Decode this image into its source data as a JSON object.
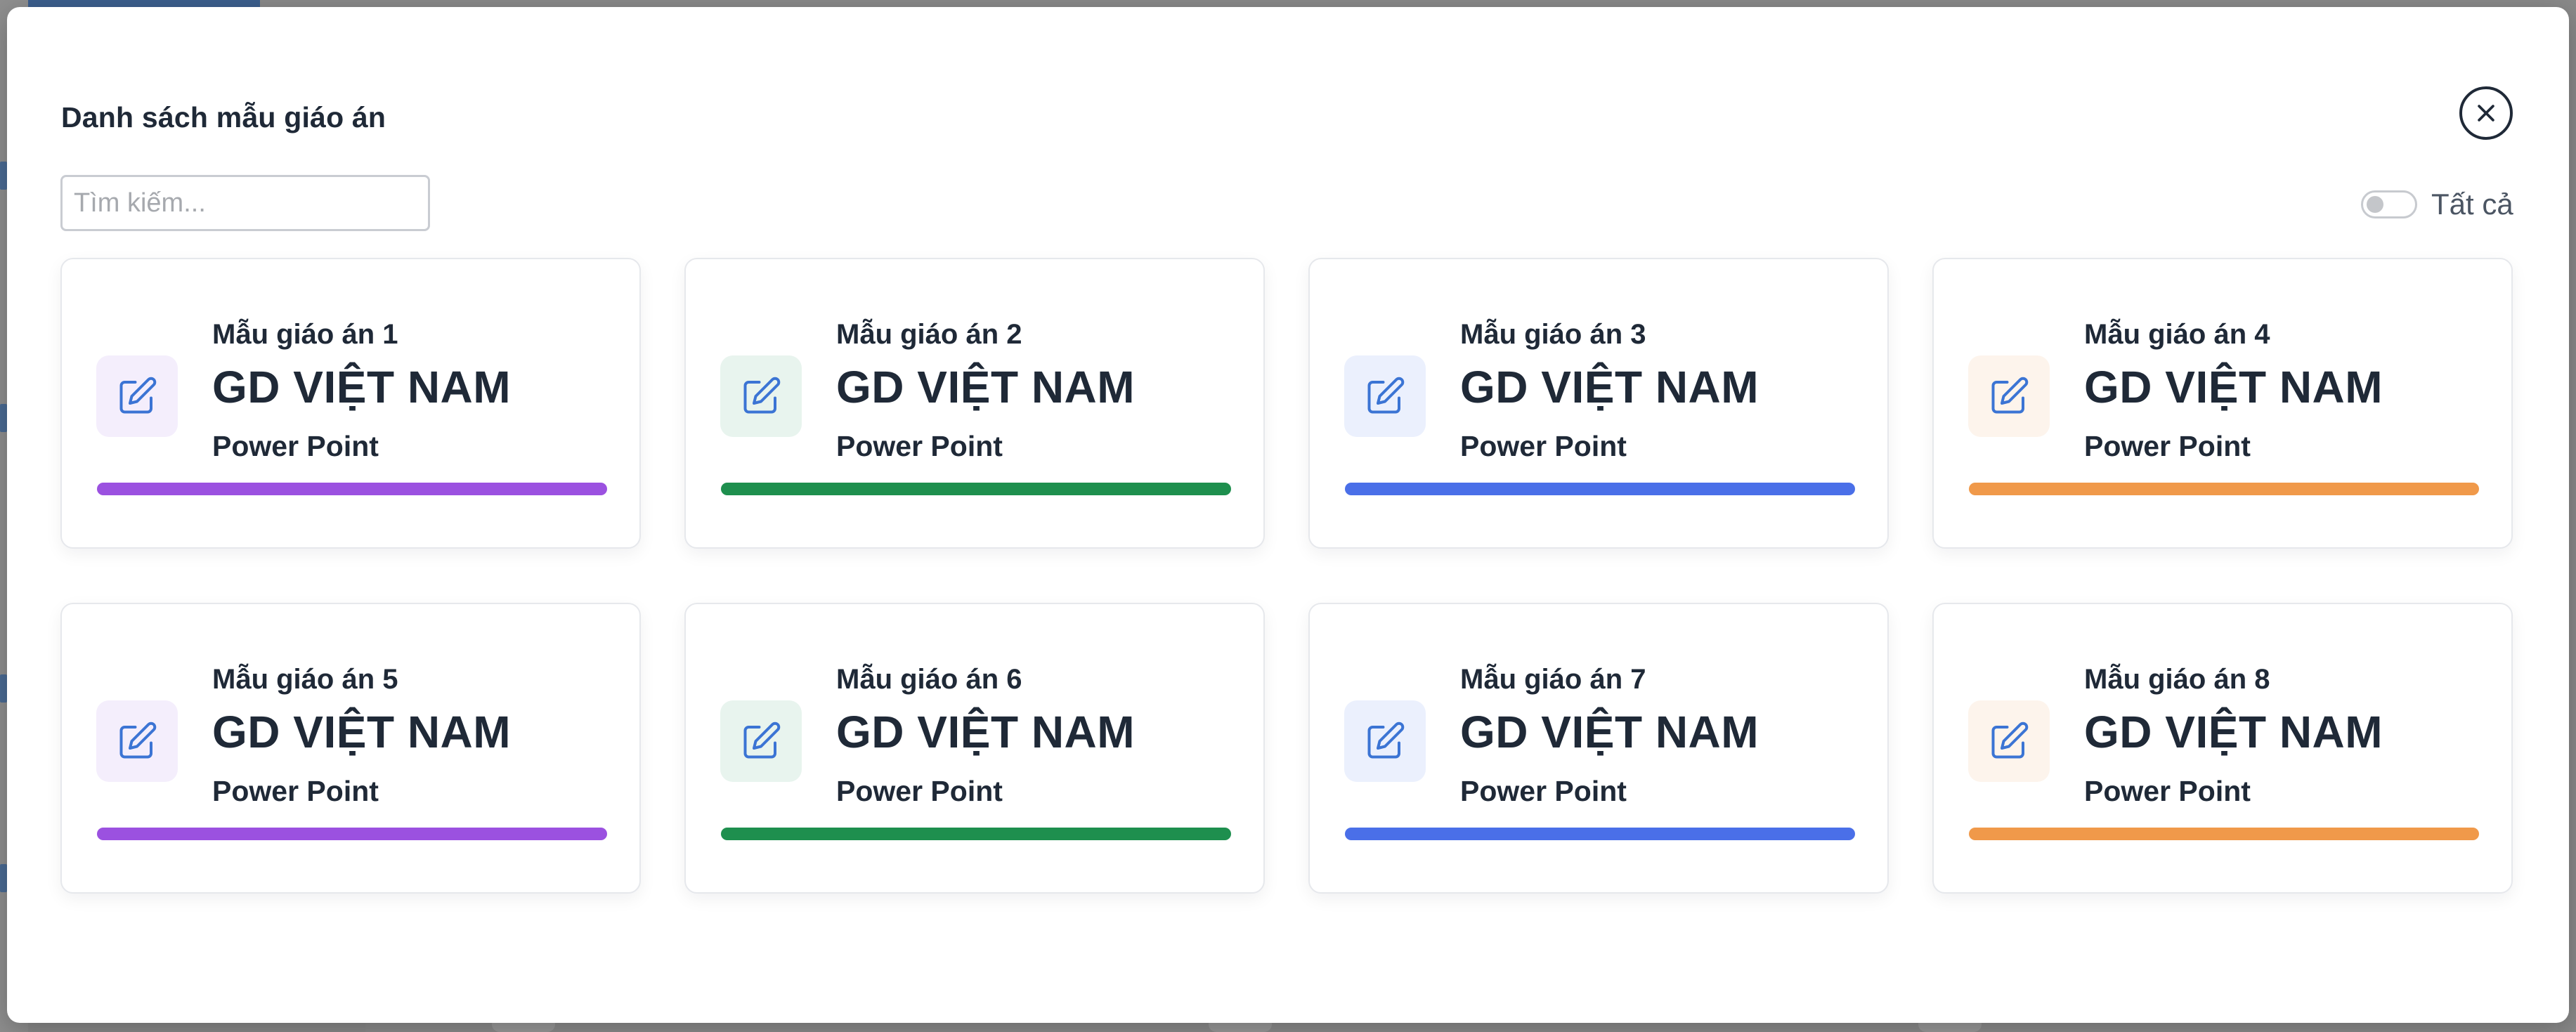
{
  "modal": {
    "title": "Danh sách mẫu giáo án",
    "close_icon": "close-icon"
  },
  "search": {
    "placeholder": "Tìm kiếm...",
    "value": ""
  },
  "filter": {
    "toggle_label": "Tất cả",
    "toggle_on": false
  },
  "cards": [
    {
      "name": "Mẫu giáo án 1",
      "org": "GD VIỆT NAM",
      "type": "Power Point",
      "accent": "#9b51e0",
      "icon_bg": "#f4eefc",
      "icon": "edit-icon"
    },
    {
      "name": "Mẫu giáo án 2",
      "org": "GD VIỆT NAM",
      "type": "Power Point",
      "accent": "#1e8f4e",
      "icon_bg": "#e8f4ee",
      "icon": "edit-icon"
    },
    {
      "name": "Mẫu giáo án 3",
      "org": "GD VIỆT NAM",
      "type": "Power Point",
      "accent": "#4a6fe8",
      "icon_bg": "#ebf0fd",
      "icon": "edit-icon"
    },
    {
      "name": "Mẫu giáo án 4",
      "org": "GD VIỆT NAM",
      "type": "Power Point",
      "accent": "#f0994a",
      "icon_bg": "#fdf4ec",
      "icon": "edit-icon"
    },
    {
      "name": "Mẫu giáo án 5",
      "org": "GD VIỆT NAM",
      "type": "Power Point",
      "accent": "#9b51e0",
      "icon_bg": "#f4eefc",
      "icon": "edit-icon"
    },
    {
      "name": "Mẫu giáo án 6",
      "org": "GD VIỆT NAM",
      "type": "Power Point",
      "accent": "#1e8f4e",
      "icon_bg": "#e8f4ee",
      "icon": "edit-icon"
    },
    {
      "name": "Mẫu giáo án 7",
      "org": "GD VIỆT NAM",
      "type": "Power Point",
      "accent": "#4a6fe8",
      "icon_bg": "#ebf0fd",
      "icon": "edit-icon"
    },
    {
      "name": "Mẫu giáo án 8",
      "org": "GD VIỆT NAM",
      "type": "Power Point",
      "accent": "#f0994a",
      "icon_bg": "#fdf4ec",
      "icon": "edit-icon"
    }
  ],
  "colors": {
    "text_primary": "#1f2937",
    "icon_stroke": "#3b74d4"
  }
}
